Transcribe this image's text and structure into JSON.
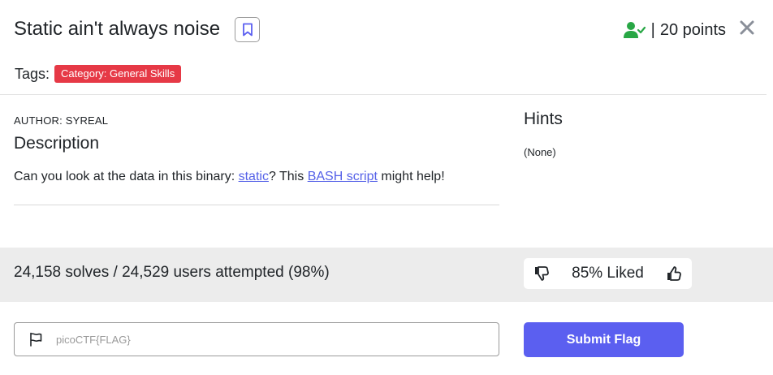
{
  "challenge": {
    "title": "Static ain't always noise",
    "points_separator": "|",
    "points": "20 points"
  },
  "tags": {
    "label": "Tags:",
    "items": [
      "Category: General Skills"
    ]
  },
  "description": {
    "author": "AUTHOR: SYREAL",
    "heading": "Description",
    "text_before": "Can you look at the data in this binary: ",
    "link1": "static",
    "text_middle": "? This ",
    "link2": "BASH script",
    "text_after": " might help!"
  },
  "hints": {
    "heading": "Hints",
    "text": "(None)"
  },
  "stats": {
    "solves": "24,158 solves / 24,529 users attempted (98%)",
    "liked": "85% Liked"
  },
  "flag_form": {
    "placeholder": "picoCTF{FLAG}",
    "value": "",
    "submit_label": "Submit Flag"
  },
  "colors": {
    "accent": "#5b5ff0",
    "badge": "#e63946",
    "solved_icon": "#28a745",
    "link": "#5561e8"
  },
  "icons": {
    "bookmark": "bookmark-icon",
    "solved": "user-check-icon",
    "close": "close-icon",
    "dislike": "thumbs-down-icon",
    "like": "thumbs-up-icon",
    "flag": "flag-icon"
  }
}
